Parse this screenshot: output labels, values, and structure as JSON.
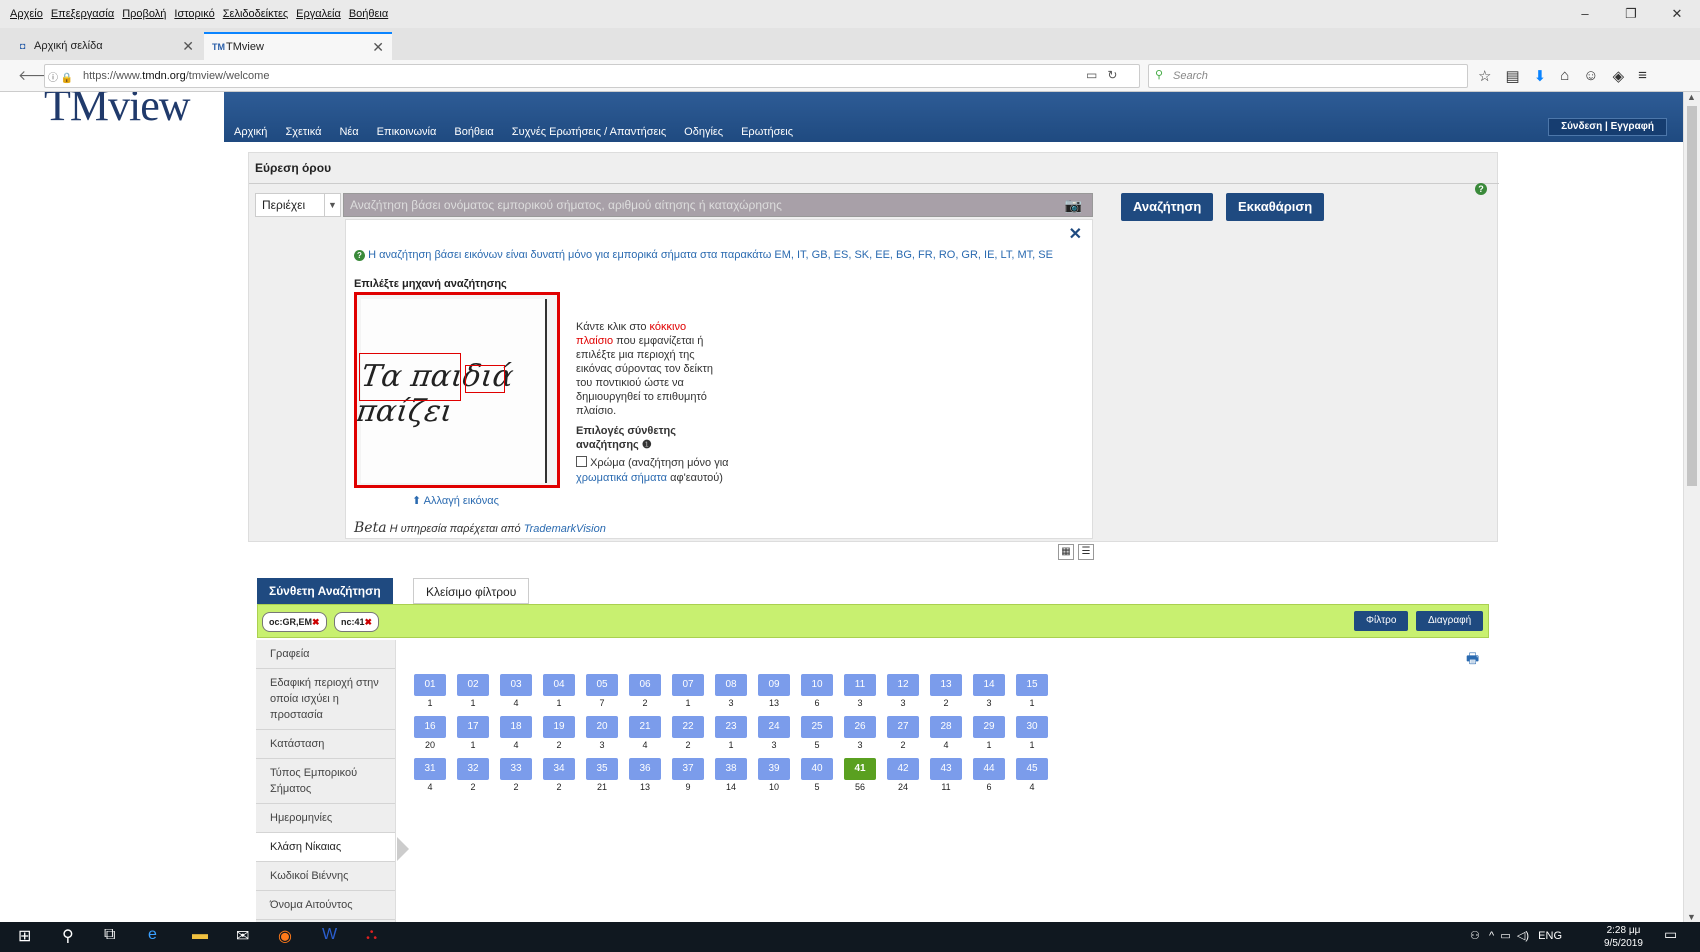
{
  "menu": [
    "Αρχείο",
    "Επεξεργασία",
    "Προβολή",
    "Ιστορικό",
    "Σελιδοδείκτες",
    "Εργαλεία",
    "Βοήθεια"
  ],
  "browser": {
    "tabs": [
      {
        "label": "Αρχική σελίδα"
      },
      {
        "label": "TMview"
      }
    ],
    "url_prefix": "https://www.",
    "url_domain": "tmdn.org",
    "url_path": "/tmview/welcome",
    "search_placeholder": "Search"
  },
  "site": {
    "logo": "TMview",
    "nav": [
      "Αρχική",
      "Σχετικά",
      "Νέα",
      "Επικοινωνία",
      "Βοήθεια",
      "Συχνές Ερωτήσεις / Απαντήσεις",
      "Οδηγίες",
      "Ερωτήσεις"
    ],
    "login": "Σύνδεση | Εγγραφή"
  },
  "search": {
    "title": "Εύρεση όρου",
    "mode": "Περιέχει",
    "placeholder": "Αναζήτηση βάσει ονόματος εμπορικού σήματος, αριθμού αίτησης ή καταχώρησης",
    "search_btn": "Αναζήτηση",
    "clear_btn": "Εκκαθάριση"
  },
  "image_search": {
    "info": "Η αναζήτηση βάσει εικόνων είναι δυνατή μόνο για εμπορικά σήματα στα παρακάτω EM, IT, GB, ES, SK, EE, BG, FR, RO, GR, IE, LT, MT, SE",
    "engine_label": "Επιλέξτε μηχανή αναζήτησης",
    "image_text": "Τα παιδιά παίζει",
    "change_image": "Αλλαγή εικόνας",
    "instr_1": "Κάντε κλικ στο ",
    "instr_red": "κόκκινο πλαίσιο",
    "instr_2": " που εμφανίζεται ή επιλέξτε μια περιοχή της εικόνας σύροντας τον δείκτη του ποντικιού ώστε να δημιουργηθεί το επιθυμητό πλαίσιο.",
    "options_title": "Επιλογές σύνθετης αναζήτησης",
    "color_1": "Χρώμα (αναζήτηση μόνο για ",
    "color_link": "χρωματικά σήματα",
    "color_2": " αφ'εαυτού)",
    "beta": "Beta",
    "provider_text": " Η υπηρεσία παρέχεται από ",
    "provider_link": "TrademarkVision"
  },
  "results": {
    "tab_active": "Σύνθετη Αναζήτηση",
    "tab_other": "Κλείσιμο φίλτρου",
    "chips": [
      "oc:GR,EM",
      "nc:41"
    ],
    "filter_btn": "Φίλτρο",
    "delete_btn": "Διαγραφή",
    "facets": [
      "Γραφεία",
      "Εδαφική περιοχή στην οποία ισχύει η προστασία",
      "Κατάσταση",
      "Τύπος Εμπορικού Σήματος",
      "Ημερομηνίες",
      "Κλάση Νίκαιας",
      "Κωδικοί Βιέννης",
      "Όνομα Αιτούντος"
    ],
    "selected_facet": 5
  },
  "classes": [
    {
      "c": "01",
      "n": 1
    },
    {
      "c": "02",
      "n": 1
    },
    {
      "c": "03",
      "n": 4
    },
    {
      "c": "04",
      "n": 1
    },
    {
      "c": "05",
      "n": 7
    },
    {
      "c": "06",
      "n": 2
    },
    {
      "c": "07",
      "n": 1
    },
    {
      "c": "08",
      "n": 3
    },
    {
      "c": "09",
      "n": 13
    },
    {
      "c": "10",
      "n": 6
    },
    {
      "c": "11",
      "n": 3
    },
    {
      "c": "12",
      "n": 3
    },
    {
      "c": "13",
      "n": 2
    },
    {
      "c": "14",
      "n": 3
    },
    {
      "c": "15",
      "n": 1
    },
    {
      "c": "16",
      "n": 20
    },
    {
      "c": "17",
      "n": 1
    },
    {
      "c": "18",
      "n": 4
    },
    {
      "c": "19",
      "n": 2
    },
    {
      "c": "20",
      "n": 3
    },
    {
      "c": "21",
      "n": 4
    },
    {
      "c": "22",
      "n": 2
    },
    {
      "c": "23",
      "n": 1
    },
    {
      "c": "24",
      "n": 3
    },
    {
      "c": "25",
      "n": 5
    },
    {
      "c": "26",
      "n": 3
    },
    {
      "c": "27",
      "n": 2
    },
    {
      "c": "28",
      "n": 4
    },
    {
      "c": "29",
      "n": 1
    },
    {
      "c": "30",
      "n": 1
    },
    {
      "c": "31",
      "n": 4
    },
    {
      "c": "32",
      "n": 2
    },
    {
      "c": "33",
      "n": 2
    },
    {
      "c": "34",
      "n": 2
    },
    {
      "c": "35",
      "n": 21
    },
    {
      "c": "36",
      "n": 13
    },
    {
      "c": "37",
      "n": 9
    },
    {
      "c": "38",
      "n": 14
    },
    {
      "c": "39",
      "n": 10
    },
    {
      "c": "40",
      "n": 5
    },
    {
      "c": "41",
      "n": 56,
      "selected": true
    },
    {
      "c": "42",
      "n": 24
    },
    {
      "c": "43",
      "n": 11
    },
    {
      "c": "44",
      "n": 6
    },
    {
      "c": "45",
      "n": 4
    }
  ],
  "taskbar": {
    "lang": "ENG",
    "time": "2:28 μμ",
    "date": "9/5/2019"
  },
  "colors": {
    "header": "#1f4a80",
    "class_tile": "#7b9ceb",
    "selected_class": "#5aa020",
    "filter_bar": "#c8f070"
  }
}
